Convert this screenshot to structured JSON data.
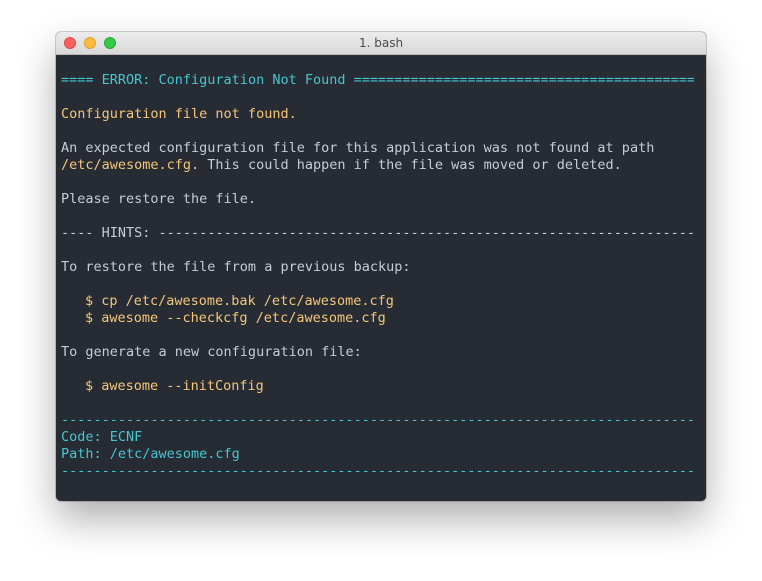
{
  "window": {
    "title": "1. bash"
  },
  "terminal": {
    "error_header": {
      "prefix": "==== ",
      "text": "ERROR: Configuration Not Found",
      "fill": " ======================================================================="
    },
    "summary": "Configuration file not found.",
    "description": {
      "line1": "An expected configuration file for this application was not found at path",
      "path": "/etc/awesome.cfg.",
      "line2_rest": " This could happen if the file was moved or deleted."
    },
    "restore_request": "Please restore the file.",
    "hints_header": {
      "prefix": "---- HINTS: ",
      "fill": "--------------------------------------------------------------------------"
    },
    "hint_backup": {
      "intro": "To restore the file from a previous backup:",
      "commands": [
        "$ cp /etc/awesome.bak /etc/awesome.cfg",
        "$ awesome --checkcfg /etc/awesome.cfg"
      ]
    },
    "hint_generate": {
      "intro": "To generate a new configuration file:",
      "commands": [
        "$ awesome --initConfig"
      ]
    },
    "footer_rule": "--------------------------------------------------------------------------------------------",
    "footer": {
      "code": "Code: ECNF",
      "path": "Path: /etc/awesome.cfg"
    }
  },
  "colors": {
    "background": "#272b33",
    "cyan": "#45c6d2",
    "yellow": "#f4c67a",
    "text": "#c6ccd7"
  }
}
